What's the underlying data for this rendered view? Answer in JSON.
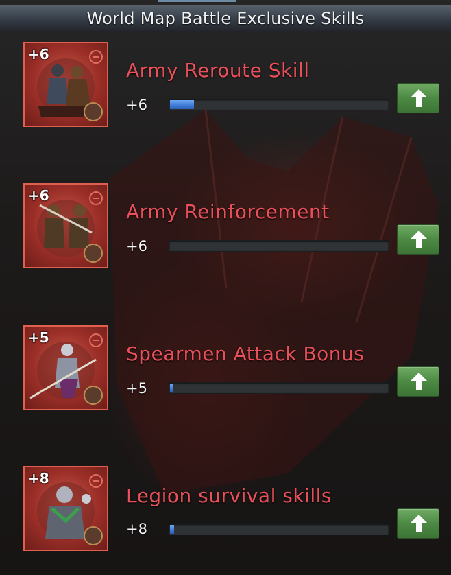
{
  "header": {
    "title": "World Map Battle Exclusive Skills"
  },
  "skills": [
    {
      "name": "Army Reroute Skill",
      "level_badge": "+6",
      "value": "+6",
      "progress": 0.11,
      "icon": "cavalry-warriors-icon"
    },
    {
      "name": "Army Reinforcement",
      "level_badge": "+6",
      "value": "+6",
      "progress": 0.0,
      "icon": "dual-warriors-icon"
    },
    {
      "name": "Spearmen Attack Bonus",
      "level_badge": "+5",
      "value": "+5",
      "progress": 0.01,
      "icon": "spearman-icon"
    },
    {
      "name": "Legion survival skills",
      "level_badge": "+8",
      "value": "+8",
      "progress": 0.02,
      "icon": "armored-soldier-icon"
    }
  ],
  "colors": {
    "skill_name": "#e8505a",
    "progress_fill": "#3f7ad6",
    "upgrade_button": "#4c8a43",
    "icon_border": "#e06050"
  }
}
